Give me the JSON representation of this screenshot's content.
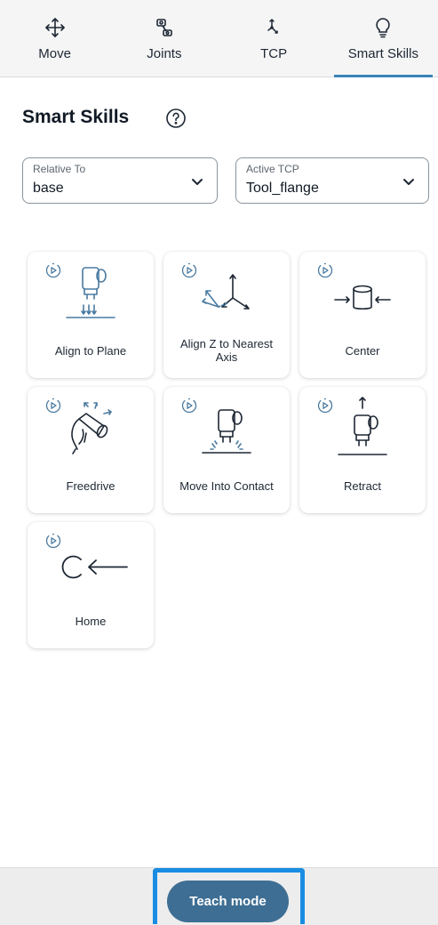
{
  "tabs": [
    {
      "label": "Move",
      "icon": "move-arrows-icon"
    },
    {
      "label": "Joints",
      "icon": "robot-joint-icon"
    },
    {
      "label": "TCP",
      "icon": "tcp-axes-icon"
    },
    {
      "label": "Smart Skills",
      "icon": "lightbulb-icon"
    }
  ],
  "active_tab": "Smart Skills",
  "section": {
    "title": "Smart Skills",
    "help_icon": "help-circle-icon"
  },
  "relative_to": {
    "label": "Relative To",
    "value": "base"
  },
  "active_tcp": {
    "label": "Active TCP",
    "value": "Tool_flange"
  },
  "skills": [
    {
      "label": "Align to Plane",
      "icon": "align-to-plane-icon"
    },
    {
      "label": "Align Z to Nearest Axis",
      "icon": "align-z-axis-icon"
    },
    {
      "label": "Center",
      "icon": "center-icon"
    },
    {
      "label": "Freedrive",
      "icon": "freedrive-icon"
    },
    {
      "label": "Move Into Contact",
      "icon": "move-into-contact-icon"
    },
    {
      "label": "Retract",
      "icon": "retract-icon"
    },
    {
      "label": "Home",
      "icon": "home-icon"
    }
  ],
  "teach_mode": {
    "label": "Teach mode"
  },
  "colors": {
    "accent": "#3a83b7",
    "icon": "#4a7aa0",
    "button": "#3e6e93",
    "focus": "#1a8de3"
  }
}
